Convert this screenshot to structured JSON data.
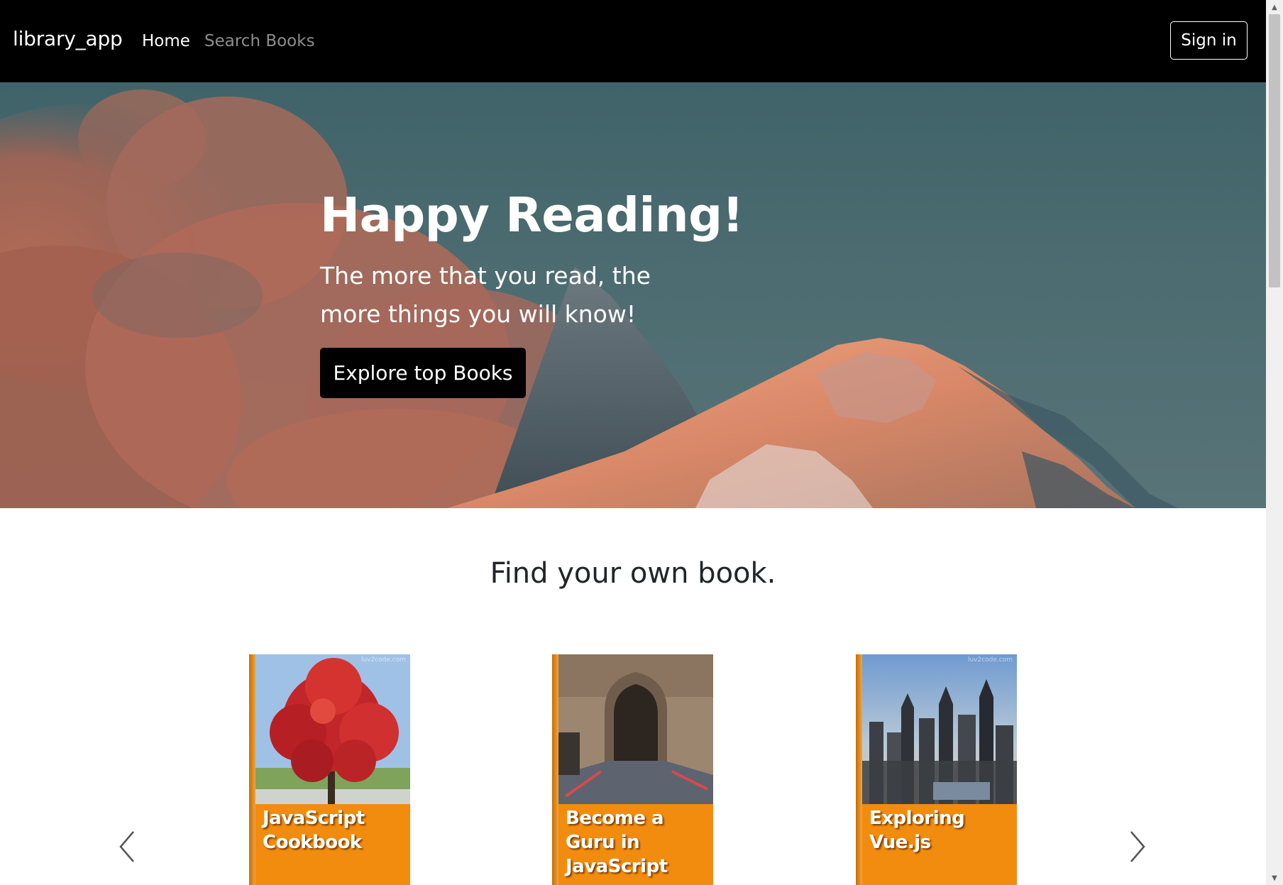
{
  "navbar": {
    "brand": "library_app",
    "links": [
      {
        "label": "Home",
        "active": true
      },
      {
        "label": "Search Books",
        "active": false
      }
    ],
    "signin_label": "Sign in"
  },
  "hero": {
    "title": "Happy Reading!",
    "subtitle": "The more that you read, the more things you will know!",
    "cta_label": "Explore top Books"
  },
  "books_section": {
    "title": "Find your own book.",
    "books": [
      {
        "title": "JavaScript Cookbook",
        "watermark": "luv2code.com"
      },
      {
        "title": "Become a Guru in JavaScript",
        "watermark": ""
      },
      {
        "title": "Exploring Vue.js",
        "watermark": "luv2code.com"
      }
    ]
  },
  "icons": {
    "carousel_prev": "chevron-left-icon",
    "carousel_next": "chevron-right-icon",
    "scroll_up": "triangle-up-icon",
    "scroll_down": "triangle-down-icon"
  },
  "colors": {
    "navbar_bg": "#000000",
    "book_cover": "#f28c0f",
    "button_dark": "#000000",
    "heading_text": "#212529"
  }
}
